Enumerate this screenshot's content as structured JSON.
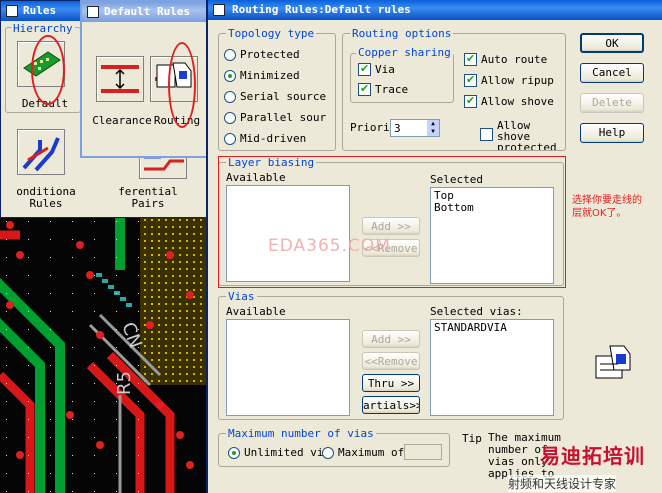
{
  "rules_window": {
    "title": "Rules",
    "hierarchy_label": "Hierarchy",
    "default_label": "Default",
    "conditional_label_1": "onditiona",
    "conditional_label_2": "Rules",
    "differential_label_1": "ferential",
    "differential_label_2": "Pairs"
  },
  "default_rules_window": {
    "title": "Default Rules",
    "clearance_label": "Clearance",
    "routing_label": "Routing"
  },
  "routing_rules": {
    "title": "Routing Rules:Default rules",
    "topology": {
      "label": "Topology type",
      "options": [
        "Protected",
        "Minimized",
        "Serial source",
        "Parallel sour",
        "Mid-driven"
      ],
      "selected_index": 1
    },
    "routing_options": {
      "label": "Routing options",
      "copper_sharing_label": "Copper sharing",
      "via_label": "Via",
      "via_checked": true,
      "trace_label": "Trace",
      "trace_checked": true,
      "auto_route_label": "Auto route",
      "auto_route_checked": true,
      "allow_ripup_label": "Allow ripup",
      "allow_ripup_checked": true,
      "allow_shove_label": "Allow shove",
      "allow_shove_checked": true,
      "allow_shove_protected_label_1": "Allow",
      "allow_shove_protected_label_2": "shove",
      "allow_shove_protected_label_3": "protected",
      "allow_shove_protected_checked": false,
      "priority_label": "Priori",
      "priority_value": "3"
    },
    "layer_biasing": {
      "label": "Layer biasing",
      "available_label": "Available",
      "available_items": [],
      "selected_label": "Selected",
      "selected_items": [
        "Top",
        "Bottom"
      ],
      "add_label": "Add >>",
      "remove_label": "<<Remove"
    },
    "vias": {
      "label": "Vias",
      "available_label": "Available",
      "available_items": [],
      "selected_label": "Selected vias:",
      "selected_items": [
        "STANDARDVIA"
      ],
      "add_label": "Add >>",
      "remove_label": "<<Remove",
      "thru_label": "Thru >>",
      "partials_label": "artials>>"
    },
    "max_vias": {
      "label": "Maximum number of vias",
      "unlimited_label": "Unlimited vi",
      "maximum_label": "Maximum of:",
      "unlimited_selected": true,
      "maximum_value": ""
    },
    "tip": {
      "label": "Tip",
      "lines": [
        "The maximum",
        "number of",
        "vias only",
        "applies to"
      ]
    },
    "buttons": {
      "ok": "OK",
      "cancel": "Cancel",
      "delete": "Delete",
      "help": "Help"
    }
  },
  "annotation": {
    "line1": "选择你要走线的",
    "line2": "层就OK了。"
  },
  "watermark": "EDA365.COM",
  "logo": {
    "main": "易迪拓培训",
    "sub": "射频和天线设计专家"
  }
}
